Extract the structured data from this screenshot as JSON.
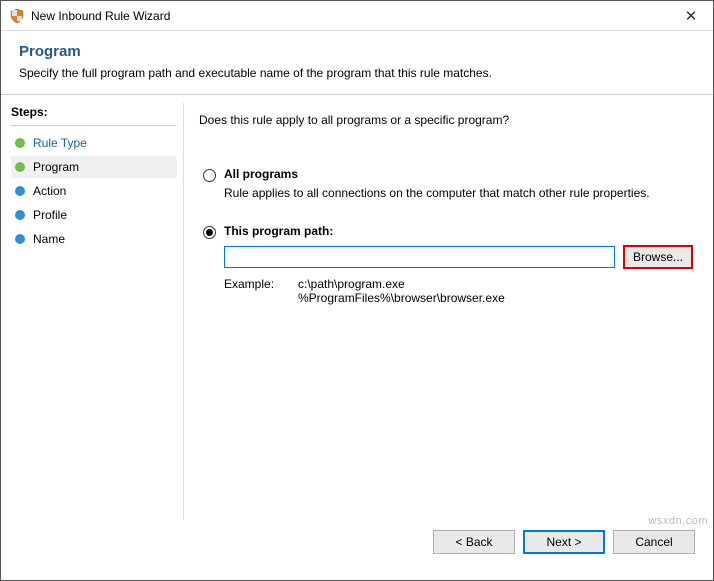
{
  "window": {
    "title": "New Inbound Rule Wizard",
    "close_symbol": "✕"
  },
  "header": {
    "title": "Program",
    "subtitle": "Specify the full program path and executable name of the program that this rule matches."
  },
  "sidebar": {
    "title": "Steps:",
    "items": [
      {
        "label": "Rule Type",
        "color": "#6fbf4a",
        "current": true,
        "active_bg": false
      },
      {
        "label": "Program",
        "color": "#6fbf4a",
        "current": false,
        "active_bg": true
      },
      {
        "label": "Action",
        "color": "#2f8fd4",
        "current": false,
        "active_bg": false
      },
      {
        "label": "Profile",
        "color": "#2f8fd4",
        "current": false,
        "active_bg": false
      },
      {
        "label": "Name",
        "color": "#2f8fd4",
        "current": false,
        "active_bg": false
      }
    ]
  },
  "main": {
    "question": "Does this rule apply to all programs or a specific program?",
    "option_all": {
      "label": "All programs",
      "desc": "Rule applies to all connections on the computer that match other rule properties.",
      "selected": false
    },
    "option_path": {
      "label": "This program path:",
      "selected": true,
      "input_value": "",
      "browse_label": "Browse...",
      "example_label": "Example:",
      "example_values": "c:\\path\\program.exe\n%ProgramFiles%\\browser\\browser.exe"
    }
  },
  "footer": {
    "back": "< Back",
    "next": "Next >",
    "cancel": "Cancel"
  },
  "watermark": "wsxdn.com"
}
